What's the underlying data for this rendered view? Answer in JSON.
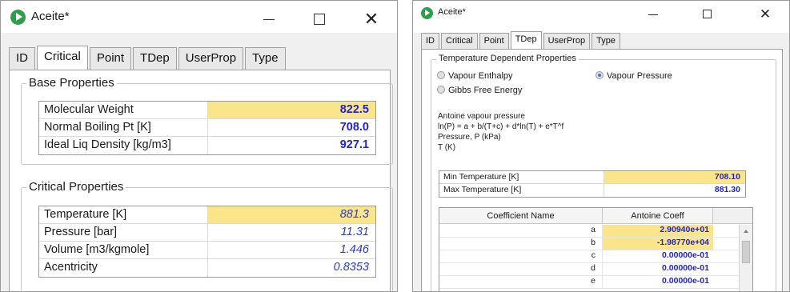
{
  "colors": {
    "value_blue": "#1e22d8",
    "highlight_yellow": "#fbe58a",
    "app_icon_green": "#2f9e4a"
  },
  "window_left": {
    "title": "Aceite*",
    "controls": {
      "minimize_icon": "minimize-icon",
      "maximize_icon": "maximize-icon",
      "close_icon": "close-icon",
      "close_glyph": "✕"
    },
    "tabs": [
      "ID",
      "Critical",
      "Point",
      "TDep",
      "UserProp",
      "Type"
    ],
    "active_tab": "Critical",
    "base_properties": {
      "title": "Base Properties",
      "rows": [
        {
          "label": "Molecular Weight",
          "value": "822.5",
          "highlight": true
        },
        {
          "label": "Normal Boiling Pt [K]",
          "value": "708.0",
          "highlight": false
        },
        {
          "label": "Ideal Liq Density [kg/m3]",
          "value": "927.1",
          "highlight": false
        }
      ]
    },
    "critical_properties": {
      "title": "Critical Properties",
      "rows": [
        {
          "label": "Temperature [K]",
          "value": "881.3",
          "highlight": true
        },
        {
          "label": "Pressure [bar]",
          "value": "11.31",
          "highlight": false
        },
        {
          "label": "Volume [m3/kgmole]",
          "value": "1.446",
          "highlight": false
        },
        {
          "label": "Acentricity",
          "value": "0.8353",
          "highlight": false
        }
      ]
    }
  },
  "window_right": {
    "title": "Aceite*",
    "controls": {
      "minimize_icon": "minimize-icon",
      "maximize_icon": "maximize-icon",
      "close_icon": "close-icon",
      "close_glyph": "✕"
    },
    "tabs": [
      "ID",
      "Critical",
      "Point",
      "TDep",
      "UserProp",
      "Type"
    ],
    "active_tab": "TDep",
    "group_title": "Temperature Dependent Properties",
    "radios": [
      {
        "label": "Vapour Enthalpy",
        "checked": false
      },
      {
        "label": "Vapour Pressure",
        "checked": true
      },
      {
        "label": "Gibbs Free Energy",
        "checked": false
      }
    ],
    "equation_lines": [
      "Antoine vapour pressure",
      "ln(P) = a + b/(T+c) + d*ln(T) + e*T^f",
      "Pressure, P (kPa)",
      "T (K)"
    ],
    "temperature_grid": [
      {
        "label": "Min Temperature [K]",
        "value": "708.10",
        "highlight": true
      },
      {
        "label": "Max Temperature [K]",
        "value": "881.30",
        "highlight": false
      }
    ],
    "coefficients": {
      "header_name": "Coefficient Name",
      "header_value": "Antoine Coeff",
      "rows": [
        {
          "name": "a",
          "value": "2.90940e+01",
          "highlight": true
        },
        {
          "name": "b",
          "value": "-1.98770e+04",
          "highlight": true
        },
        {
          "name": "c",
          "value": "0.00000e-01",
          "highlight": false
        },
        {
          "name": "d",
          "value": "0.00000e-01",
          "highlight": false
        },
        {
          "name": "e",
          "value": "0.00000e-01",
          "highlight": false
        }
      ]
    }
  }
}
